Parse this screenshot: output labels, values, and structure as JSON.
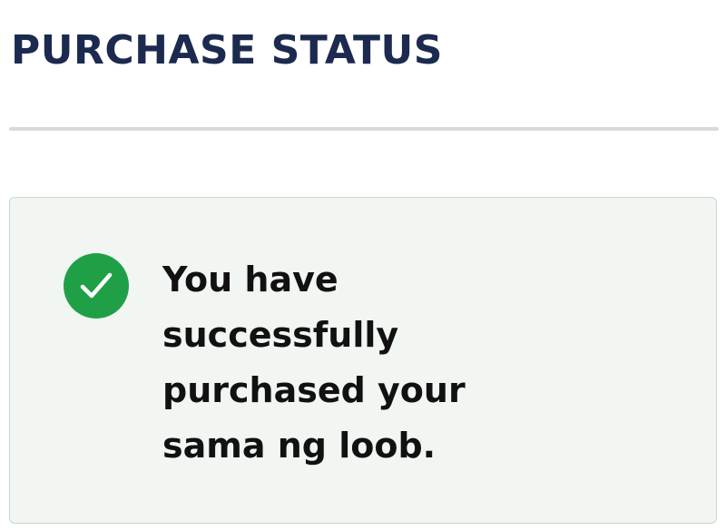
{
  "header": {
    "title": "PURCHASE STATUS"
  },
  "status": {
    "icon": "check-circle-icon",
    "message": "You have successfully purchased your sama ng loob.",
    "colors": {
      "success": "#1fa047",
      "title": "#1b2a4e",
      "card_background": "#f1f6f2",
      "card_border": "#c8d7cd"
    }
  }
}
